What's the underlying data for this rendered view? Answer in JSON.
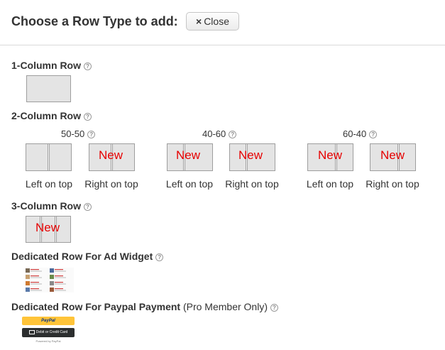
{
  "header": {
    "title": "Choose a Row Type to add:",
    "close_label": "Close",
    "close_icon": "×"
  },
  "help_icon": "?",
  "sections": {
    "one_col": "1-Column Row",
    "two_col": "2-Column Row",
    "three_col": "3-Column Row",
    "ad": "Dedicated Row For Ad Widget",
    "paypal": "Dedicated Row For Paypal Payment",
    "paypal_note": "(Pro Member Only)"
  },
  "ratios": [
    "50-50",
    "40-60",
    "60-40"
  ],
  "captions": {
    "left": "Left on top",
    "right": "Right on top"
  },
  "new_badge": "New",
  "paypal_button": {
    "brand": "PayPal",
    "card": "Debit or Credit Card",
    "powered": "Powered by PayPal"
  }
}
